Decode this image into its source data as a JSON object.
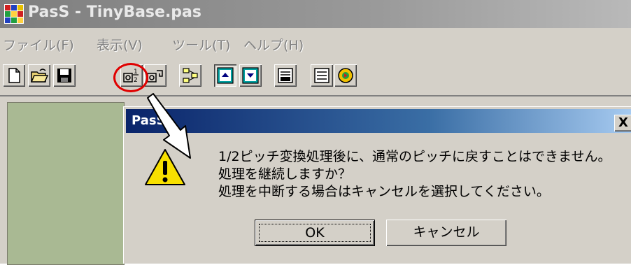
{
  "window": {
    "title": "PasS - TinyBase.pas"
  },
  "menu": [
    {
      "label": "ファイル(F)"
    },
    {
      "label": "表示(V)"
    },
    {
      "label": "ツール(T)"
    },
    {
      "label": "ヘルプ(H)"
    }
  ],
  "toolbar": {
    "buttons": [
      {
        "icon": "new-file-icon"
      },
      {
        "icon": "open-folder-icon"
      },
      {
        "icon": "save-icon"
      },
      {
        "icon": "half-pitch-convert-icon",
        "highlighted": true
      },
      {
        "icon": "pitch-convert-icon"
      },
      {
        "icon": "structure-icon"
      },
      {
        "icon": "view-upper-icon",
        "pressed": true
      },
      {
        "icon": "view-lower-icon"
      },
      {
        "icon": "msc-icon"
      },
      {
        "icon": "list-settings-icon"
      },
      {
        "icon": "play-icon"
      }
    ],
    "highlight_color": "#e00000"
  },
  "dialog": {
    "title": "PasS",
    "close_label": "X",
    "icon": "warning-icon",
    "message_lines": [
      "1/2ピッチ変換処理後に、通常のピッチに戻すことはできません。",
      "処理を継続しますか？",
      "処理を中断する場合はキャンセルを選択してください。"
    ],
    "ok_label": "OK",
    "cancel_label": "キャンセル"
  },
  "colors": {
    "dialog_title_gradient_start": "#0a246a",
    "dialog_title_gradient_end": "#a6caf0",
    "face": "#d4d0c8",
    "pane": "#a9b993"
  }
}
